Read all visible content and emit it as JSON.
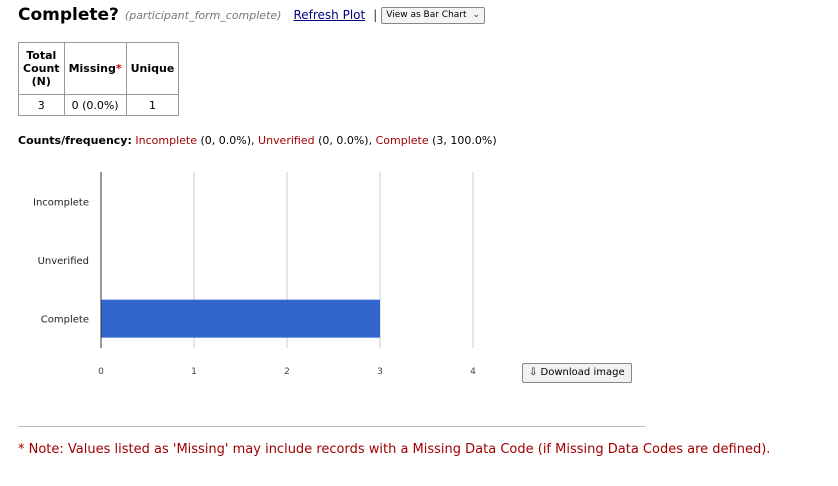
{
  "header": {
    "title": "Complete?",
    "field_name": "(participant_form_complete)",
    "refresh_label": "Refresh Plot",
    "separator": "|",
    "view_select": "View as Bar Chart"
  },
  "stats_table": {
    "headers": {
      "total_line1": "Total",
      "total_line2": "Count",
      "total_line3": "(N)",
      "missing": "Missing",
      "missing_marker": "*",
      "unique": "Unique"
    },
    "values": {
      "total": "3",
      "missing": "0 (0.0%)",
      "unique": "1"
    }
  },
  "counts": {
    "label": "Counts/frequency:",
    "items": [
      {
        "category": "Incomplete",
        "detail": " (0, 0.0%)",
        "sep": ", "
      },
      {
        "category": "Unverified",
        "detail": " (0, 0.0%)",
        "sep": ", "
      },
      {
        "category": "Complete",
        "detail": " (3, 100.0%)",
        "sep": ""
      }
    ]
  },
  "chart_data": {
    "type": "bar",
    "orientation": "horizontal",
    "categories": [
      "Incomplete",
      "Unverified",
      "Complete"
    ],
    "values": [
      0,
      0,
      3
    ],
    "xlim": [
      0,
      4
    ],
    "xticks": [
      0,
      1,
      2,
      3,
      4
    ],
    "grid": true,
    "bar_color": "#3366cc"
  },
  "download_label": "⇩ Download image",
  "note": "*  Note: Values listed as 'Missing' may include records with a Missing Data Code (if Missing Data Codes are defined)."
}
